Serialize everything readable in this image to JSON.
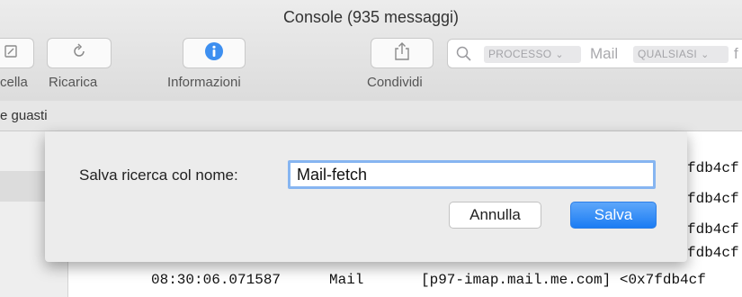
{
  "window": {
    "title": "Console (935 messaggi)"
  },
  "toolbar": {
    "clear_label": "cella",
    "reload_label": "Ricarica",
    "info_label": "Informazioni",
    "share_label": "Condividi"
  },
  "search": {
    "token_process": "PROCESSO",
    "value_process": "Mail",
    "token_any": "QUALSIASI",
    "value_partial": "f"
  },
  "favorites": {
    "item": "e guasti"
  },
  "log": {
    "fragment": "fdb4cf",
    "row": {
      "time": "08:30:06.071587",
      "process": "Mail",
      "message": "[p97-imap.mail.me.com] <0x7fdb4cf"
    }
  },
  "dialog": {
    "prompt": "Salva ricerca col nome:",
    "name_value": "Mail-fetch",
    "cancel_label": "Annulla",
    "save_label": "Salva"
  },
  "colors": {
    "accent": "#1b7cf3",
    "focus_ring": "#86b5f1",
    "info_icon": "#3d8ff0"
  }
}
